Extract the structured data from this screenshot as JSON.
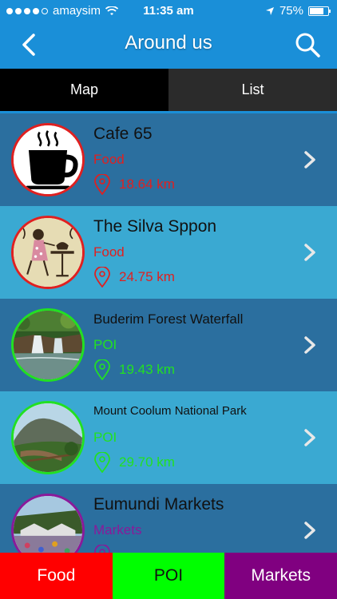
{
  "status": {
    "carrier": "amaysim",
    "time": "11:35 am",
    "battery": "75%",
    "battery_level": 0.75
  },
  "nav": {
    "title": "Around us"
  },
  "tabs": [
    {
      "label": "Map",
      "active": true
    },
    {
      "label": "List",
      "active": false
    }
  ],
  "places": [
    {
      "name": "Cafe 65",
      "category": "Food",
      "distance": "18.64 km",
      "color": "#e02020",
      "icon": "coffee-cup"
    },
    {
      "name": "The Silva Sppon",
      "category": "Food",
      "distance": "24.75 km",
      "color": "#e02020",
      "icon": "tea-lady"
    },
    {
      "name": "Buderim Forest Waterfall",
      "category": "POI",
      "distance": "19.43 km",
      "color": "#22e022",
      "icon": "waterfall-photo"
    },
    {
      "name": "Mount Coolum National Park",
      "category": "POI",
      "distance": "29.70 km",
      "color": "#22e022",
      "icon": "mountain-photo"
    },
    {
      "name": "Eumundi Markets",
      "category": "Markets",
      "distance": "",
      "color": "#8a1a9a",
      "icon": "markets-photo"
    }
  ],
  "bottom_tabs": [
    {
      "label": "Food",
      "bg": "#ff0000",
      "fg": "#ffffff"
    },
    {
      "label": "POI",
      "bg": "#00ff00",
      "fg": "#111111"
    },
    {
      "label": "Markets",
      "bg": "#800080",
      "fg": "#ffffff"
    }
  ]
}
